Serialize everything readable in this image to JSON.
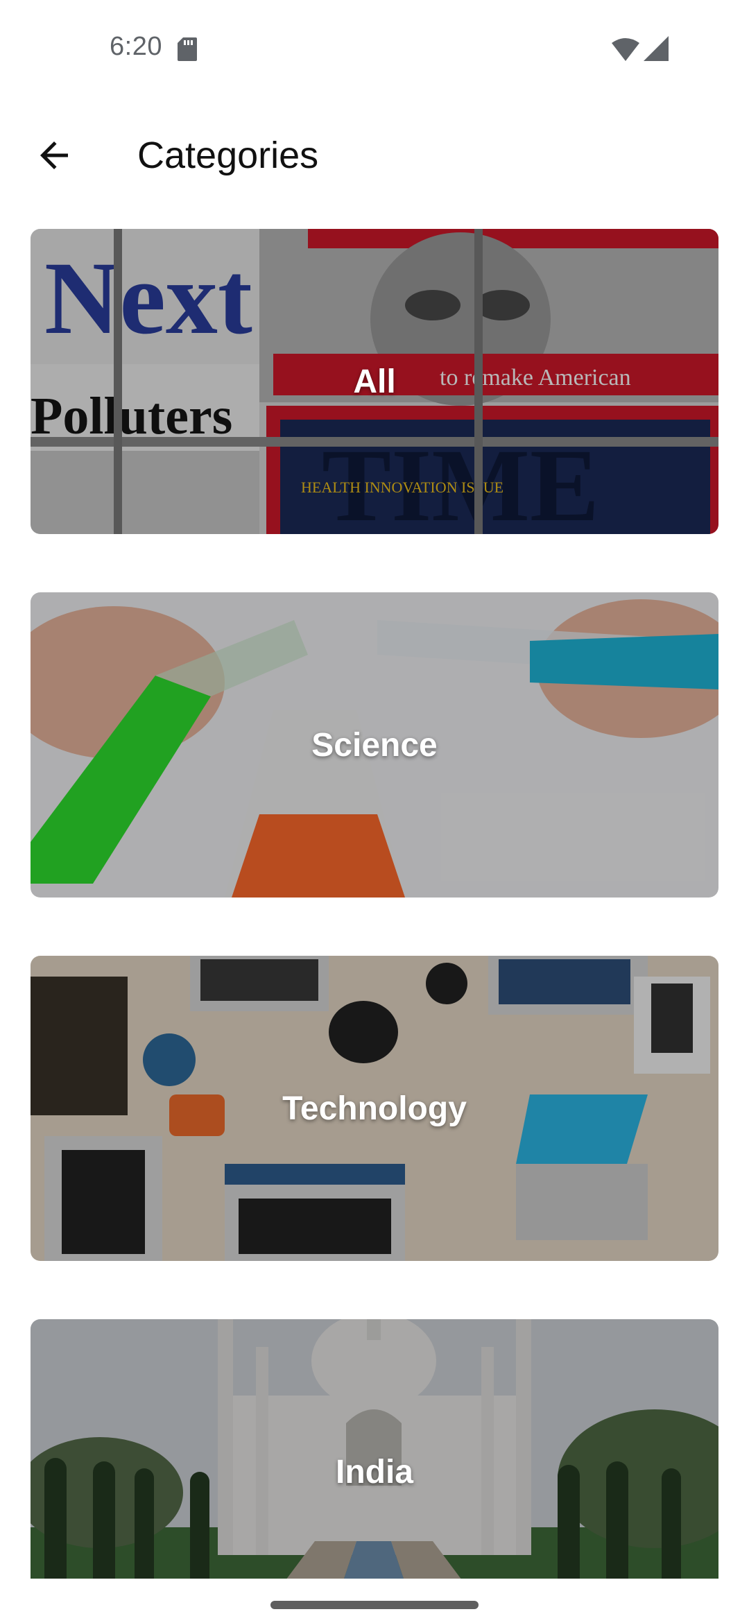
{
  "status_bar": {
    "time": "6:20",
    "icons": [
      "sd-card-icon",
      "wifi-icon",
      "cell-signal-icon"
    ]
  },
  "app_bar": {
    "back_icon": "arrow-back-icon",
    "title": "Categories"
  },
  "categories": [
    {
      "label": "All",
      "image": "magazine-rack-photo"
    },
    {
      "label": "Science",
      "image": "lab-test-tubes-photo"
    },
    {
      "label": "Technology",
      "image": "laptops-on-desk-photo"
    },
    {
      "label": "India",
      "image": "taj-mahal-photo"
    }
  ],
  "colors": {
    "background": "#ffffff",
    "title_text": "#111111",
    "status_text": "#5f6368",
    "card_label": "#ffffff"
  }
}
